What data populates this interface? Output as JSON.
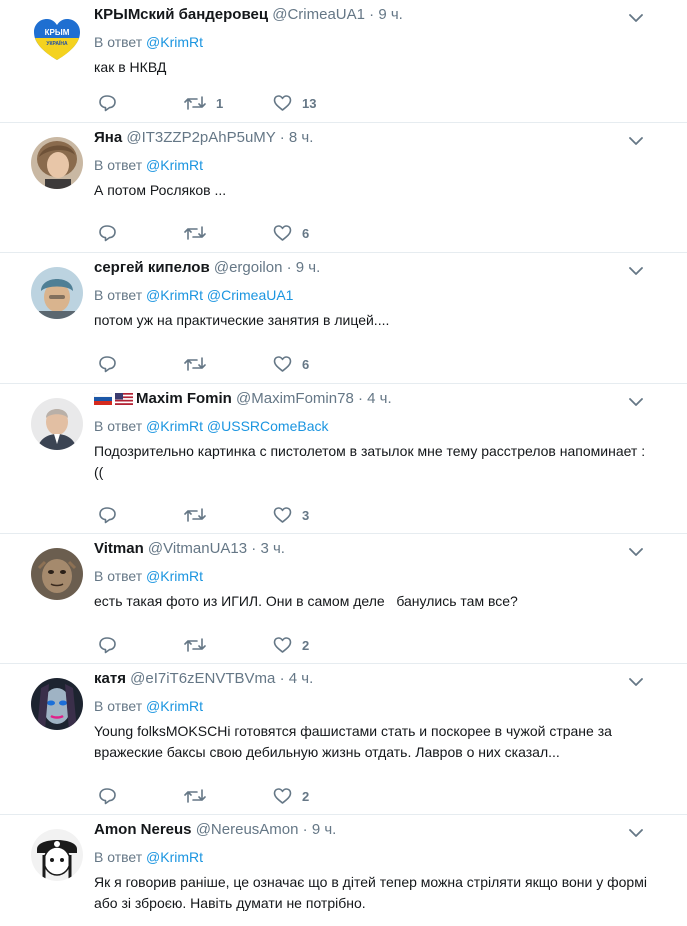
{
  "reply_prefix": "В ответ",
  "tweets": [
    {
      "name": "КРЫМский бандеровец",
      "handle": "@CrimeaUA1",
      "time": "9 ч.",
      "mentions": [
        "@KrimRt"
      ],
      "text": "как в НКВД",
      "retweets": "1",
      "likes": "13",
      "avatar_text": "КРЫМ\nУКРАЇНА"
    },
    {
      "name": "Яна",
      "handle": "@IT3ZZP2pAhP5uMY",
      "time": "8 ч.",
      "mentions": [
        "@KrimRt"
      ],
      "text": "А потом Росляков ...",
      "retweets": "",
      "likes": "6"
    },
    {
      "name": "сергей кипелов",
      "handle": "@ergoilon",
      "time": "9 ч.",
      "mentions": [
        "@KrimRt",
        "@CrimeaUA1"
      ],
      "text": "потом уж на практические занятия в лицей....",
      "retweets": "",
      "likes": "6"
    },
    {
      "name": "Maxim Fomin",
      "handle": "@MaximFomin78",
      "time": "4 ч.",
      "mentions": [
        "@KrimRt",
        "@USSRComeBack"
      ],
      "text": "Подозрительно картинка с пистолетом в затылок мне тему расстрелов напоминает :((",
      "retweets": "",
      "likes": "3"
    },
    {
      "name": "Vitman",
      "handle": "@VitmanUA13",
      "time": "3 ч.",
      "mentions": [
        "@KrimRt"
      ],
      "text": "есть такая фото из ИГИЛ. Они в самом деле   банулись там все?",
      "retweets": "",
      "likes": "2"
    },
    {
      "name": "катя",
      "handle": "@eI7iT6zENVTBVma",
      "time": "4 ч.",
      "mentions": [
        "@KrimRt"
      ],
      "text": "Young folksMOKSCHi готовятся  фашистами стать и поскорее в чужой стране за вражеские баксы свою дебильную жизнь отдать. Лавров о них сказал...",
      "retweets": "",
      "likes": "2"
    },
    {
      "name": "Amon Nereus",
      "handle": "@NereusAmon",
      "time": "9 ч.",
      "mentions": [
        "@KrimRt"
      ],
      "text": "Як я говорив раніше, це означає що в дітей тепер можна стріляти якщо вони у формі або зі зброєю. Навіть думати не потрібно.",
      "retweets": "",
      "likes": ""
    }
  ]
}
